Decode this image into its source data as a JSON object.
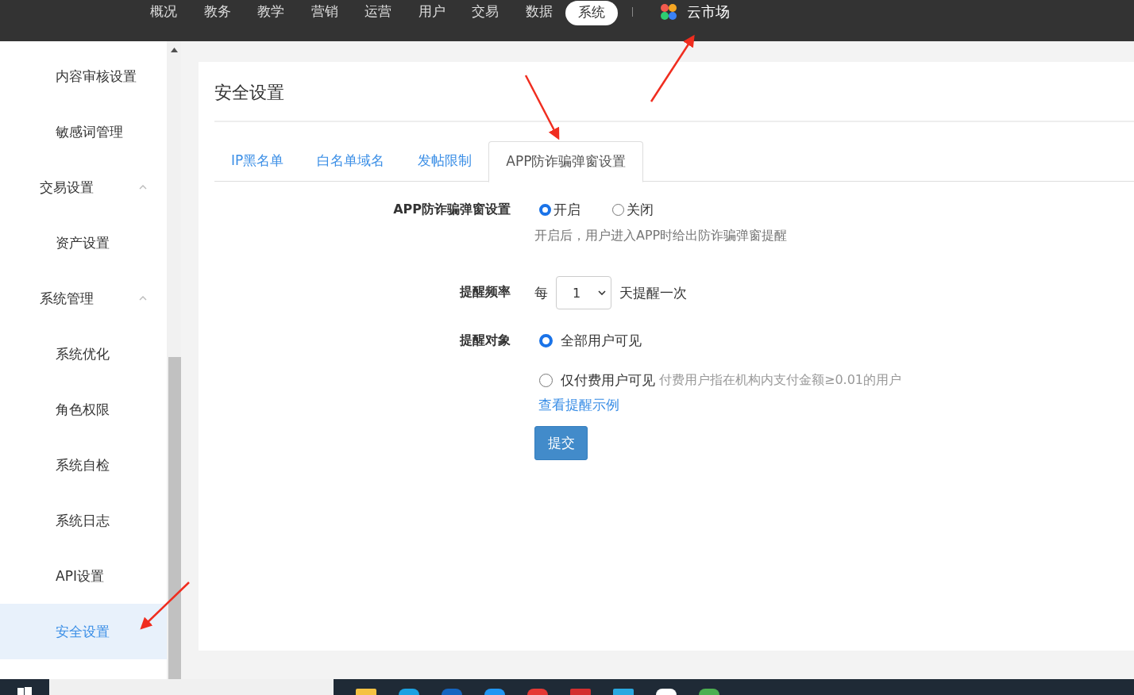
{
  "top_nav": {
    "items": [
      {
        "label": "概况",
        "selected": false
      },
      {
        "label": "教务",
        "selected": false
      },
      {
        "label": "教学",
        "selected": false
      },
      {
        "label": "营销",
        "selected": false
      },
      {
        "label": "运营",
        "selected": false
      },
      {
        "label": "用户",
        "selected": false
      },
      {
        "label": "交易",
        "selected": false
      },
      {
        "label": "数据",
        "selected": false
      },
      {
        "label": "系统",
        "selected": true
      }
    ],
    "market": "云市场"
  },
  "sidebar": {
    "items": [
      {
        "label": "内容审核设置",
        "selected": false
      },
      {
        "label": "敏感词管理",
        "selected": false
      },
      {
        "label": "交易设置",
        "expanded": true,
        "children": [
          {
            "label": "资产设置",
            "selected": false
          }
        ]
      },
      {
        "label": "系统管理",
        "expanded": true,
        "children": [
          {
            "label": "系统优化",
            "selected": false
          },
          {
            "label": "角色权限",
            "selected": false
          },
          {
            "label": "系统自检",
            "selected": false
          },
          {
            "label": "系统日志",
            "selected": false
          },
          {
            "label": "API设置",
            "selected": false
          },
          {
            "label": "安全设置",
            "selected": true
          }
        ]
      }
    ]
  },
  "page": {
    "title": "安全设置",
    "tabs": [
      {
        "label": "IP黑名单",
        "selected": false
      },
      {
        "label": "白名单域名",
        "selected": false
      },
      {
        "label": "发帖限制",
        "selected": false
      },
      {
        "label": "APP防诈骗弹窗设置",
        "selected": true
      }
    ],
    "form": {
      "popup": {
        "label": "APP防诈骗弹窗设置",
        "options": [
          {
            "label": "开启",
            "selected": true
          },
          {
            "label": "关闭",
            "selected": false
          }
        ],
        "hint": "开启后，用户进入APP时给出防诈骗弹窗提醒"
      },
      "frequency": {
        "label": "提醒频率",
        "prefix": "每",
        "value": "1",
        "suffix": "天提醒一次"
      },
      "audience": {
        "label": "提醒对象",
        "options": [
          {
            "label": "全部用户可见",
            "selected": true
          },
          {
            "label": "仅付费用户可见",
            "note": "付费用户指在机构内支付金额≥0.01的用户",
            "selected": false
          }
        ],
        "link": "查看提醒示例"
      },
      "submit": "提交"
    }
  }
}
